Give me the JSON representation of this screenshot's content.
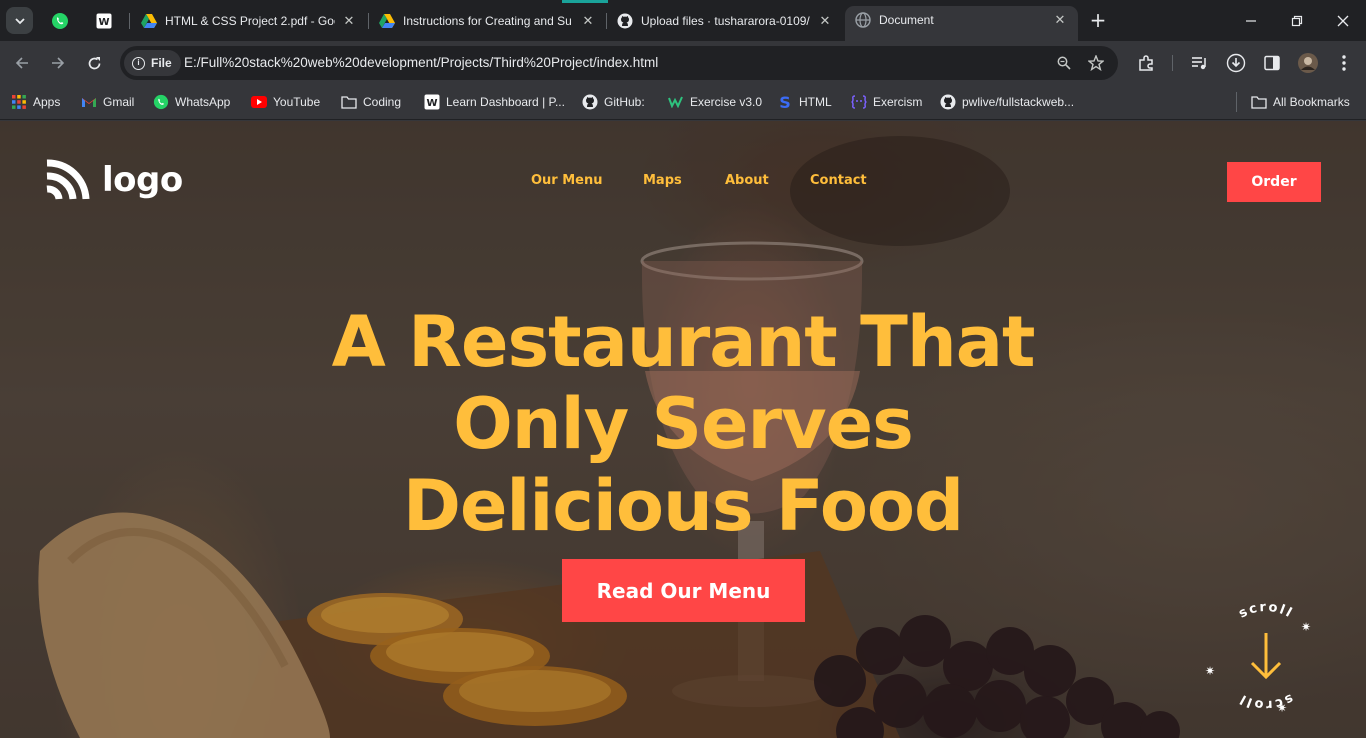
{
  "browser": {
    "pinned_tabs": [
      "WhatsApp",
      "WordPress"
    ],
    "tabs": [
      {
        "title": "HTML & CSS Project 2.pdf - Goo",
        "icon": "google-drive-icon"
      },
      {
        "title": "Instructions for Creating and Su",
        "icon": "google-drive-icon"
      },
      {
        "title": "Upload files · tushararora-0109/",
        "icon": "github-icon"
      },
      {
        "title": "Document",
        "icon": "globe-icon",
        "active": true
      }
    ],
    "address": {
      "chip_label": "File",
      "url": "E:/Full%20stack%20web%20development/Projects/Third%20Project/index.html"
    },
    "bookmarks": [
      {
        "label": "Apps",
        "icon": "apps-grid-icon"
      },
      {
        "label": "Gmail",
        "icon": "gmail-icon"
      },
      {
        "label": "WhatsApp",
        "icon": "whatsapp-icon"
      },
      {
        "label": "YouTube",
        "icon": "youtube-icon"
      },
      {
        "label": "Coding",
        "icon": "folder-icon"
      },
      {
        "label": "Learn Dashboard | P...",
        "icon": "wordpress-icon"
      },
      {
        "label": "GitHub:",
        "icon": "github-icon"
      },
      {
        "label": "Exercise v3.0",
        "icon": "exercise-icon"
      },
      {
        "label": "HTML",
        "icon": "html-s-icon"
      },
      {
        "label": "Exercism",
        "icon": "exercism-icon"
      },
      {
        "label": "pwlive/fullstackweb...",
        "icon": "github-icon"
      }
    ],
    "all_bookmarks": "All Bookmarks"
  },
  "page": {
    "logo_text": "logo",
    "nav": [
      "Our Menu",
      "Maps",
      "About",
      "Contact"
    ],
    "order_button": "Order",
    "headline_lines": [
      "A Restaurant That",
      "Only Serves",
      "Delicious Food"
    ],
    "cta_button": "Read Our Menu",
    "scroll_badge_text": "scroll",
    "colors": {
      "accent_yellow": "#ffbe3b",
      "accent_red": "#ff4646",
      "logo_white": "#ffffff"
    }
  }
}
